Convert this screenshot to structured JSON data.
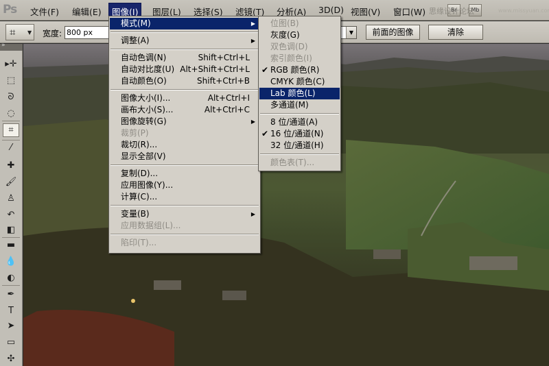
{
  "app": {
    "logo": "Ps"
  },
  "menubar": {
    "items": [
      {
        "id": "file",
        "label": "文件(F)"
      },
      {
        "id": "edit",
        "label": "编辑(E)"
      },
      {
        "id": "image",
        "label": "图像(I)",
        "active": true
      },
      {
        "id": "layer",
        "label": "图层(L)"
      },
      {
        "id": "select",
        "label": "选择(S)"
      },
      {
        "id": "filter",
        "label": "滤镜(T)"
      },
      {
        "id": "analysis",
        "label": "分析(A)"
      },
      {
        "id": "3d",
        "label": "3D(D)"
      },
      {
        "id": "view",
        "label": "视图(V)"
      },
      {
        "id": "window",
        "label": "窗口(W)"
      }
    ],
    "bridge_icon": "Br",
    "minibridge_icon": "Mb",
    "watermark": "思缘设计论坛",
    "watermark2": "www.missyuan.com"
  },
  "options": {
    "width_label": "宽度:",
    "width_value": "800 px",
    "front_image_label": "前面的图像",
    "clear_label": "清除"
  },
  "tools": [
    {
      "name": "move-tool",
      "glyph": "▸✛"
    },
    {
      "name": "marquee-tool",
      "glyph": "⬚"
    },
    {
      "name": "lasso-tool",
      "glyph": "ᘐ"
    },
    {
      "name": "quick-select-tool",
      "glyph": "◌"
    },
    {
      "name": "crop-tool",
      "glyph": "⌗",
      "selected": true
    },
    {
      "name": "eyedropper-tool",
      "glyph": "⁄"
    },
    {
      "name": "healing-brush-tool",
      "glyph": "✚"
    },
    {
      "name": "brush-tool",
      "glyph": "🖌"
    },
    {
      "name": "clone-stamp-tool",
      "glyph": "♙"
    },
    {
      "name": "history-brush-tool",
      "glyph": "↶"
    },
    {
      "name": "eraser-tool",
      "glyph": "◧"
    },
    {
      "name": "gradient-tool",
      "glyph": "▬"
    },
    {
      "name": "blur-tool",
      "glyph": "💧"
    },
    {
      "name": "dodge-tool",
      "glyph": "◐"
    },
    {
      "name": "pen-tool",
      "glyph": "✒"
    },
    {
      "name": "type-tool",
      "glyph": "T"
    },
    {
      "name": "path-select-tool",
      "glyph": "➤"
    },
    {
      "name": "shape-tool",
      "glyph": "▭"
    },
    {
      "name": "3d-rotate-tool",
      "glyph": "✣"
    }
  ],
  "image_menu": {
    "items": [
      {
        "id": "mode",
        "label": "模式(M)",
        "submenu": true,
        "highlighted": true
      },
      {
        "sep": true
      },
      {
        "id": "adjustments",
        "label": "调整(A)",
        "submenu": true
      },
      {
        "sep": true
      },
      {
        "id": "auto-tone",
        "label": "自动色调(N)",
        "shortcut": "Shift+Ctrl+L"
      },
      {
        "id": "auto-contrast",
        "label": "自动对比度(U)",
        "shortcut": "Alt+Shift+Ctrl+L"
      },
      {
        "id": "auto-color",
        "label": "自动颜色(O)",
        "shortcut": "Shift+Ctrl+B"
      },
      {
        "sep": true
      },
      {
        "id": "image-size",
        "label": "图像大小(I)...",
        "shortcut": "Alt+Ctrl+I"
      },
      {
        "id": "canvas-size",
        "label": "画布大小(S)...",
        "shortcut": "Alt+Ctrl+C"
      },
      {
        "id": "image-rotation",
        "label": "图像旋转(G)",
        "submenu": true
      },
      {
        "id": "crop",
        "label": "裁剪(P)",
        "disabled": true
      },
      {
        "id": "trim",
        "label": "裁切(R)..."
      },
      {
        "id": "reveal-all",
        "label": "显示全部(V)"
      },
      {
        "sep": true
      },
      {
        "id": "duplicate",
        "label": "复制(D)..."
      },
      {
        "id": "apply-image",
        "label": "应用图像(Y)..."
      },
      {
        "id": "calculations",
        "label": "计算(C)..."
      },
      {
        "sep": true
      },
      {
        "id": "variables",
        "label": "变量(B)",
        "submenu": true
      },
      {
        "id": "apply-data-set",
        "label": "应用数据组(L)...",
        "disabled": true
      },
      {
        "sep": true
      },
      {
        "id": "trap",
        "label": "陷印(T)...",
        "disabled": true
      }
    ]
  },
  "mode_submenu": {
    "items": [
      {
        "id": "bitmap",
        "label": "位图(B)",
        "disabled": true
      },
      {
        "id": "grayscale",
        "label": "灰度(G)"
      },
      {
        "id": "duotone",
        "label": "双色调(D)",
        "disabled": true
      },
      {
        "id": "indexed-color",
        "label": "索引颜色(I)",
        "disabled": true
      },
      {
        "id": "rgb-color",
        "label": "RGB 颜色(R)",
        "checked": true
      },
      {
        "id": "cmyk-color",
        "label": "CMYK 颜色(C)"
      },
      {
        "id": "lab-color",
        "label": "Lab 颜色(L)",
        "highlighted": true
      },
      {
        "id": "multichannel",
        "label": "多通道(M)"
      },
      {
        "sep": true
      },
      {
        "id": "8-bit",
        "label": "8 位/通道(A)"
      },
      {
        "id": "16-bit",
        "label": "16 位/通道(N)",
        "checked": true
      },
      {
        "id": "32-bit",
        "label": "32 位/通道(H)"
      },
      {
        "sep": true
      },
      {
        "id": "color-table",
        "label": "颜色表(T)...",
        "disabled": true
      }
    ]
  }
}
